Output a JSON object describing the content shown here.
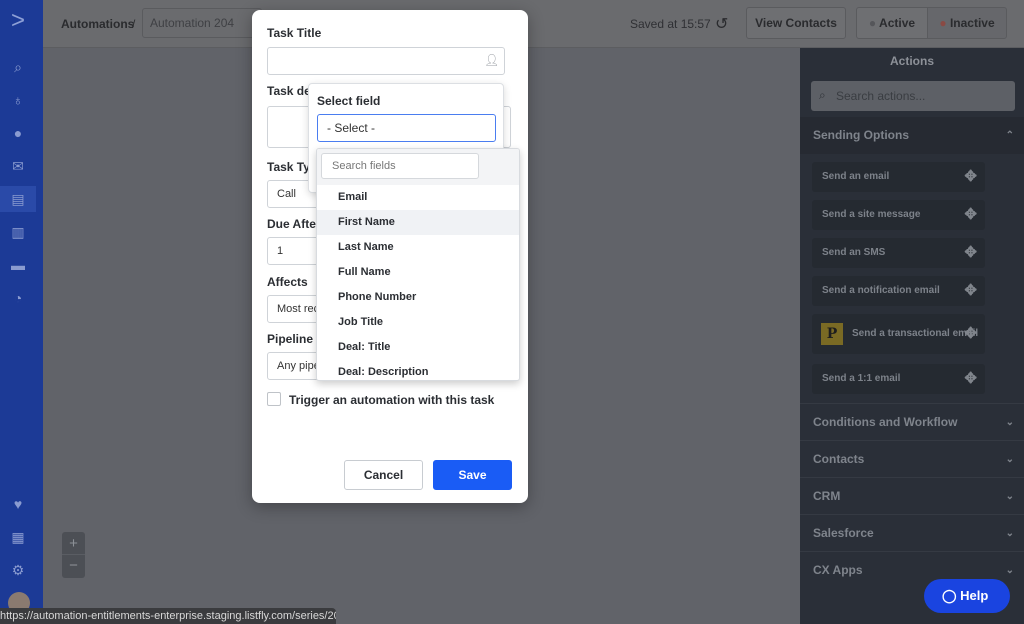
{
  "header": {
    "breadcrumb_root": "Automations",
    "breadcrumb_sep": "/",
    "automation_name": "Automation 204",
    "saved_status": "Saved at 15:57",
    "view_contacts": "View Contacts",
    "active": "Active",
    "inactive": "Inactive",
    "inactive_color": "#c0544a"
  },
  "sidebar": {
    "brand_color": "#1c3a96",
    "icons": [
      "logo-icon",
      "search-icon",
      "lightbulb-icon",
      "contacts-icon",
      "email-icon",
      "automations-icon",
      "pipelines-icon",
      "campaigns-icon",
      "reports-icon",
      "heart-icon",
      "apps-icon",
      "settings-icon",
      "avatar"
    ]
  },
  "canvas": {
    "zoom_in": "+",
    "zoom_out": "−"
  },
  "modal": {
    "task_title_label": "Task Title",
    "task_title_value": "",
    "task_desc_label": "Task des",
    "task_type_label": "Task Typ",
    "task_type_value": "Call",
    "due_after_label": "Due After",
    "due_after_value": "1",
    "affects_label": "Affects",
    "affects_value": "Most rec",
    "pipeline_label": "Pipeline",
    "pipeline_value": "Any pipe",
    "trigger_label": "Trigger an automation with this task",
    "trigger_checked": false,
    "cancel": "Cancel",
    "save": "Save",
    "save_color": "#1a5cf5"
  },
  "select_field": {
    "title": "Select field",
    "value": "- Select -",
    "search_placeholder": "Search fields",
    "hovered": "First Name",
    "options": [
      "Email",
      "First Name",
      "Last Name",
      "Full Name",
      "Phone Number",
      "Job Title",
      "Deal: Title",
      "Deal: Description"
    ]
  },
  "actions_panel": {
    "title": "Actions",
    "search_placeholder": "Search actions...",
    "sending_options": "Sending Options",
    "items": [
      "Send an email",
      "Send a site message",
      "Send an SMS",
      "Send a notification email",
      "Send a transactional email",
      "Send a 1:1 email"
    ],
    "postmark_badge": "P",
    "categories": [
      "Conditions and Workflow",
      "Contacts",
      "CRM",
      "Salesforce",
      "CX Apps"
    ]
  },
  "help": {
    "label": "Help"
  },
  "status_url": "https://automation-entitlements-enterprise.staging.listfly.com/series/20..."
}
